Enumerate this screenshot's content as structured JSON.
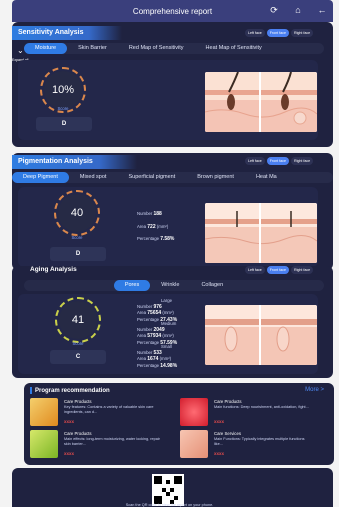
{
  "topbar": {
    "title": "Comprehensive report"
  },
  "face_toggle": {
    "left": "Left face",
    "front": "Front face",
    "right": "Right face"
  },
  "sensitivity": {
    "title": "Sensitivity Analysis",
    "expand_label": "Expand all",
    "tabs": [
      "Moisture",
      "Skin Barrier",
      "Red Map of Sensitivity",
      "Heat Map of Sensitivity"
    ],
    "score": "10%",
    "score_label": "Score",
    "grade": "D"
  },
  "pigmentation": {
    "title": "Pigmentation Analysis",
    "tabs": [
      "Deep Pigment",
      "Mixed spot",
      "Superficial pigment",
      "Brown pigment",
      "Heat Ma"
    ],
    "score": "40",
    "score_label": "Score",
    "grade": "D",
    "number_label": "Number",
    "number": "188",
    "area_label": "Area",
    "area": "722",
    "area_unit": "(mm²)",
    "pct_label": "Percentage",
    "pct": "7.58%"
  },
  "aging": {
    "title": "Aging Analysis",
    "tabs": [
      "Pores",
      "Wrinkle",
      "Collagen"
    ],
    "score": "41",
    "score_label": "Score",
    "grade": "C",
    "large": {
      "label": "Large",
      "number": "976",
      "area": "75654",
      "pct": "27.43%"
    },
    "medium": {
      "label": "Medium",
      "number": "2049",
      "area": "57934",
      "pct": "57.59%"
    },
    "small": {
      "label": "Small",
      "number": "533",
      "area": "1674",
      "pct": "14.98%"
    },
    "number_label": "Number",
    "area_label": "Area",
    "pct_label": "Percentage",
    "area_unit": "(mm²)"
  },
  "program": {
    "title": "Program recommendation",
    "more": "More >",
    "items": [
      {
        "title": "Care Products",
        "desc": "Key features: Contains a variety of valuable skin care ingredients, can d...",
        "price": "xxxx"
      },
      {
        "title": "Care Products",
        "desc": "Main functions: Deep nourishment, anti-oxidation, fight...",
        "price": "xxxx"
      },
      {
        "title": "Care Products",
        "desc": "Main effects: long-term moisturizing, water locking, repair skin barrier...",
        "price": "xxxx"
      },
      {
        "title": "Care Services",
        "desc": "Main Functions: Typically integrates multiple functions like...",
        "price": "xxxx"
      }
    ]
  },
  "qr": {
    "caption": "Scan the QR code to view the report on your phone."
  },
  "colors": {
    "accent": "#2f7be4",
    "panel": "#1f2240",
    "price": "#e34c4c"
  }
}
